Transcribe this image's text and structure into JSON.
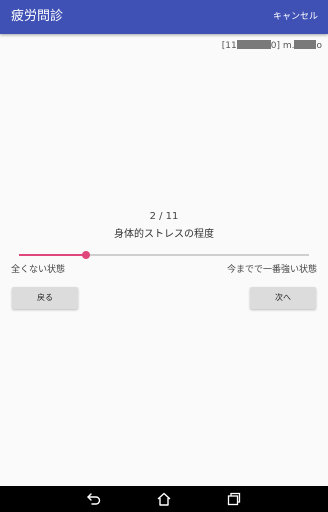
{
  "app_bar": {
    "title": "疲労問診",
    "cancel_label": "キャンセル"
  },
  "user_info": {
    "open_bracket": "[11",
    "bracket_end": "0]",
    "name_prefix": "m.",
    "name_suffix": "o"
  },
  "question": {
    "progress": "2 / 11",
    "text": "身体的ストレスの程度",
    "min_label": "全くない状態",
    "max_label": "今までで一番強い状態",
    "value_fraction": 0.23
  },
  "buttons": {
    "back_label": "戻る",
    "next_label": "次へ"
  },
  "colors": {
    "app_bar": "#3f51b5",
    "accent": "#e0457b",
    "button": "#dcdcdc",
    "background": "#fafafa"
  },
  "icons": {
    "nav_back": "back-arrow-icon",
    "nav_home": "home-icon",
    "nav_recent": "recent-apps-icon"
  }
}
